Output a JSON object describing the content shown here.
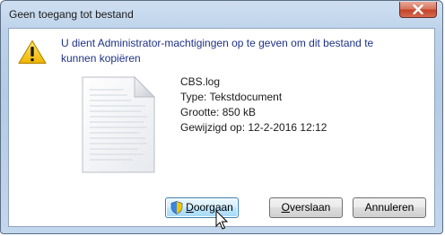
{
  "dialog": {
    "title": "Geen toegang tot bestand",
    "message": "U dient Administrator-machtigingen op te geven om dit bestand te kunnen kopiëren"
  },
  "file": {
    "name": "CBS.log",
    "type": "Type: Tekstdocument",
    "size": "Grootte: 850 kB",
    "modified": "Gewijzigd op: 12-2-2016 12:12"
  },
  "buttons": {
    "continue_rest": "oorgaan",
    "continue_mnemonic": "D",
    "skip_mnemonic": "O",
    "skip_rest": "verslaan",
    "cancel": "Annuleren"
  },
  "icons": {
    "warning": "warning-icon",
    "file": "text-file-icon",
    "shield": "uac-shield-icon",
    "close": "close-icon"
  },
  "colors": {
    "message_text": "#1e3287",
    "close_button": "#c2442a",
    "warning_yellow": "#f5c400"
  }
}
